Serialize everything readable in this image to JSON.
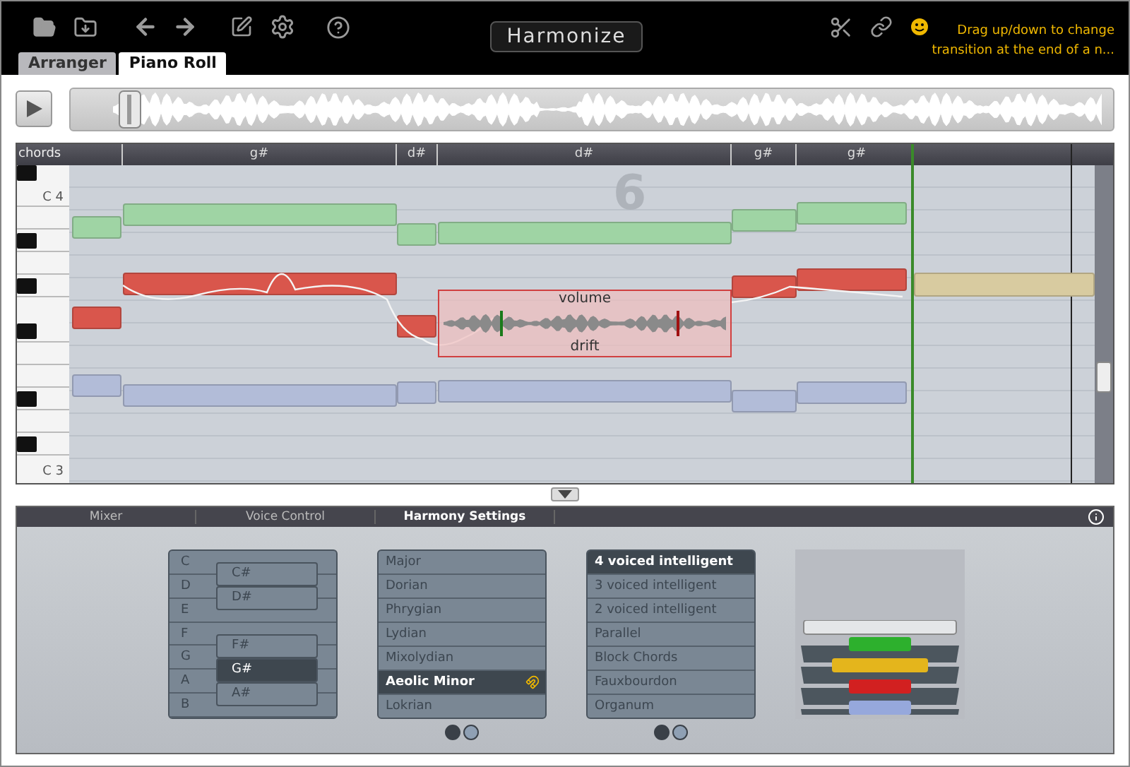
{
  "toolbar": {
    "title_button": "Harmonize",
    "tooltip": [
      "Drag up/down to change",
      "transition at the end of a n..."
    ]
  },
  "tabs": [
    {
      "label": "Arranger",
      "selected": false
    },
    {
      "label": "Piano Roll",
      "selected": true
    }
  ],
  "piano_roll": {
    "chords_label": "chords",
    "chords": [
      "g#",
      "d#",
      "d#",
      "g#",
      "g#"
    ],
    "key_labels": [
      "C 4",
      "C 3"
    ],
    "bar_number": "6",
    "note_editor": {
      "top_label": "volume",
      "bottom_label": "drift"
    }
  },
  "panel_tabs": [
    {
      "label": "Mixer",
      "selected": false
    },
    {
      "label": "Voice Control",
      "selected": false
    },
    {
      "label": "Harmony Settings",
      "selected": true
    }
  ],
  "white_keys": [
    "C",
    "D",
    "E",
    "F",
    "G",
    "A",
    "B"
  ],
  "black_keys": [
    {
      "label": "C#",
      "selected": false
    },
    {
      "label": "D#",
      "selected": false
    },
    {
      "label": "F#",
      "selected": false
    },
    {
      "label": "G#",
      "selected": true
    },
    {
      "label": "A#",
      "selected": false
    }
  ],
  "scales": [
    {
      "label": "Major",
      "selected": false
    },
    {
      "label": "Dorian",
      "selected": false
    },
    {
      "label": "Phrygian",
      "selected": false
    },
    {
      "label": "Lydian",
      "selected": false
    },
    {
      "label": "Mixolydian",
      "selected": false
    },
    {
      "label": "Aeolic Minor",
      "selected": true
    },
    {
      "label": "Lokrian",
      "selected": false
    }
  ],
  "scale_pages": [
    {
      "selected": true
    },
    {
      "selected": false
    }
  ],
  "voicings": [
    {
      "label": "4 voiced intelligent",
      "selected": true
    },
    {
      "label": "3 voiced intelligent",
      "selected": false
    },
    {
      "label": "2 voiced intelligent",
      "selected": false
    },
    {
      "label": "Parallel",
      "selected": false
    },
    {
      "label": "Block Chords",
      "selected": false
    },
    {
      "label": "Fauxbourdon",
      "selected": false
    },
    {
      "label": "Organum",
      "selected": false
    }
  ],
  "voicing_pages": [
    {
      "selected": true
    },
    {
      "selected": false
    }
  ]
}
